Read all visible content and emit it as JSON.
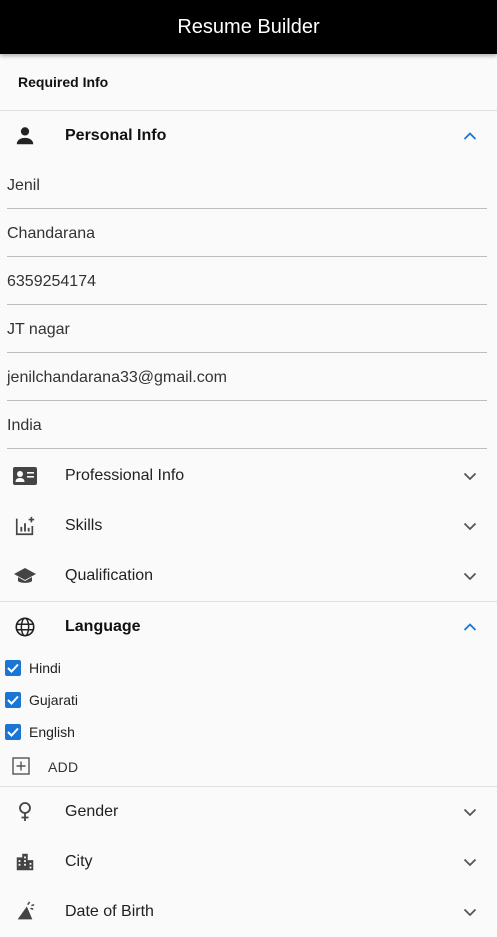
{
  "app": {
    "title": "Resume Builder"
  },
  "required_label": "Required Info",
  "personal": {
    "title": "Personal Info",
    "fields": [
      "Jenil",
      "Chandarana",
      "6359254174",
      "JT nagar",
      "jenilchandarana33@gmail.com",
      "India"
    ]
  },
  "professional": {
    "title": "Professional Info"
  },
  "skills": {
    "title": "Skills"
  },
  "qualification": {
    "title": "Qualification"
  },
  "language": {
    "title": "Language",
    "items": [
      "Hindi",
      "Gujarati",
      "English"
    ],
    "add_label": "ADD"
  },
  "gender": {
    "title": "Gender"
  },
  "city": {
    "title": "City"
  },
  "dob": {
    "title": "Date of Birth"
  },
  "colors": {
    "accent": "#1976d2",
    "appbar": "#000000"
  }
}
